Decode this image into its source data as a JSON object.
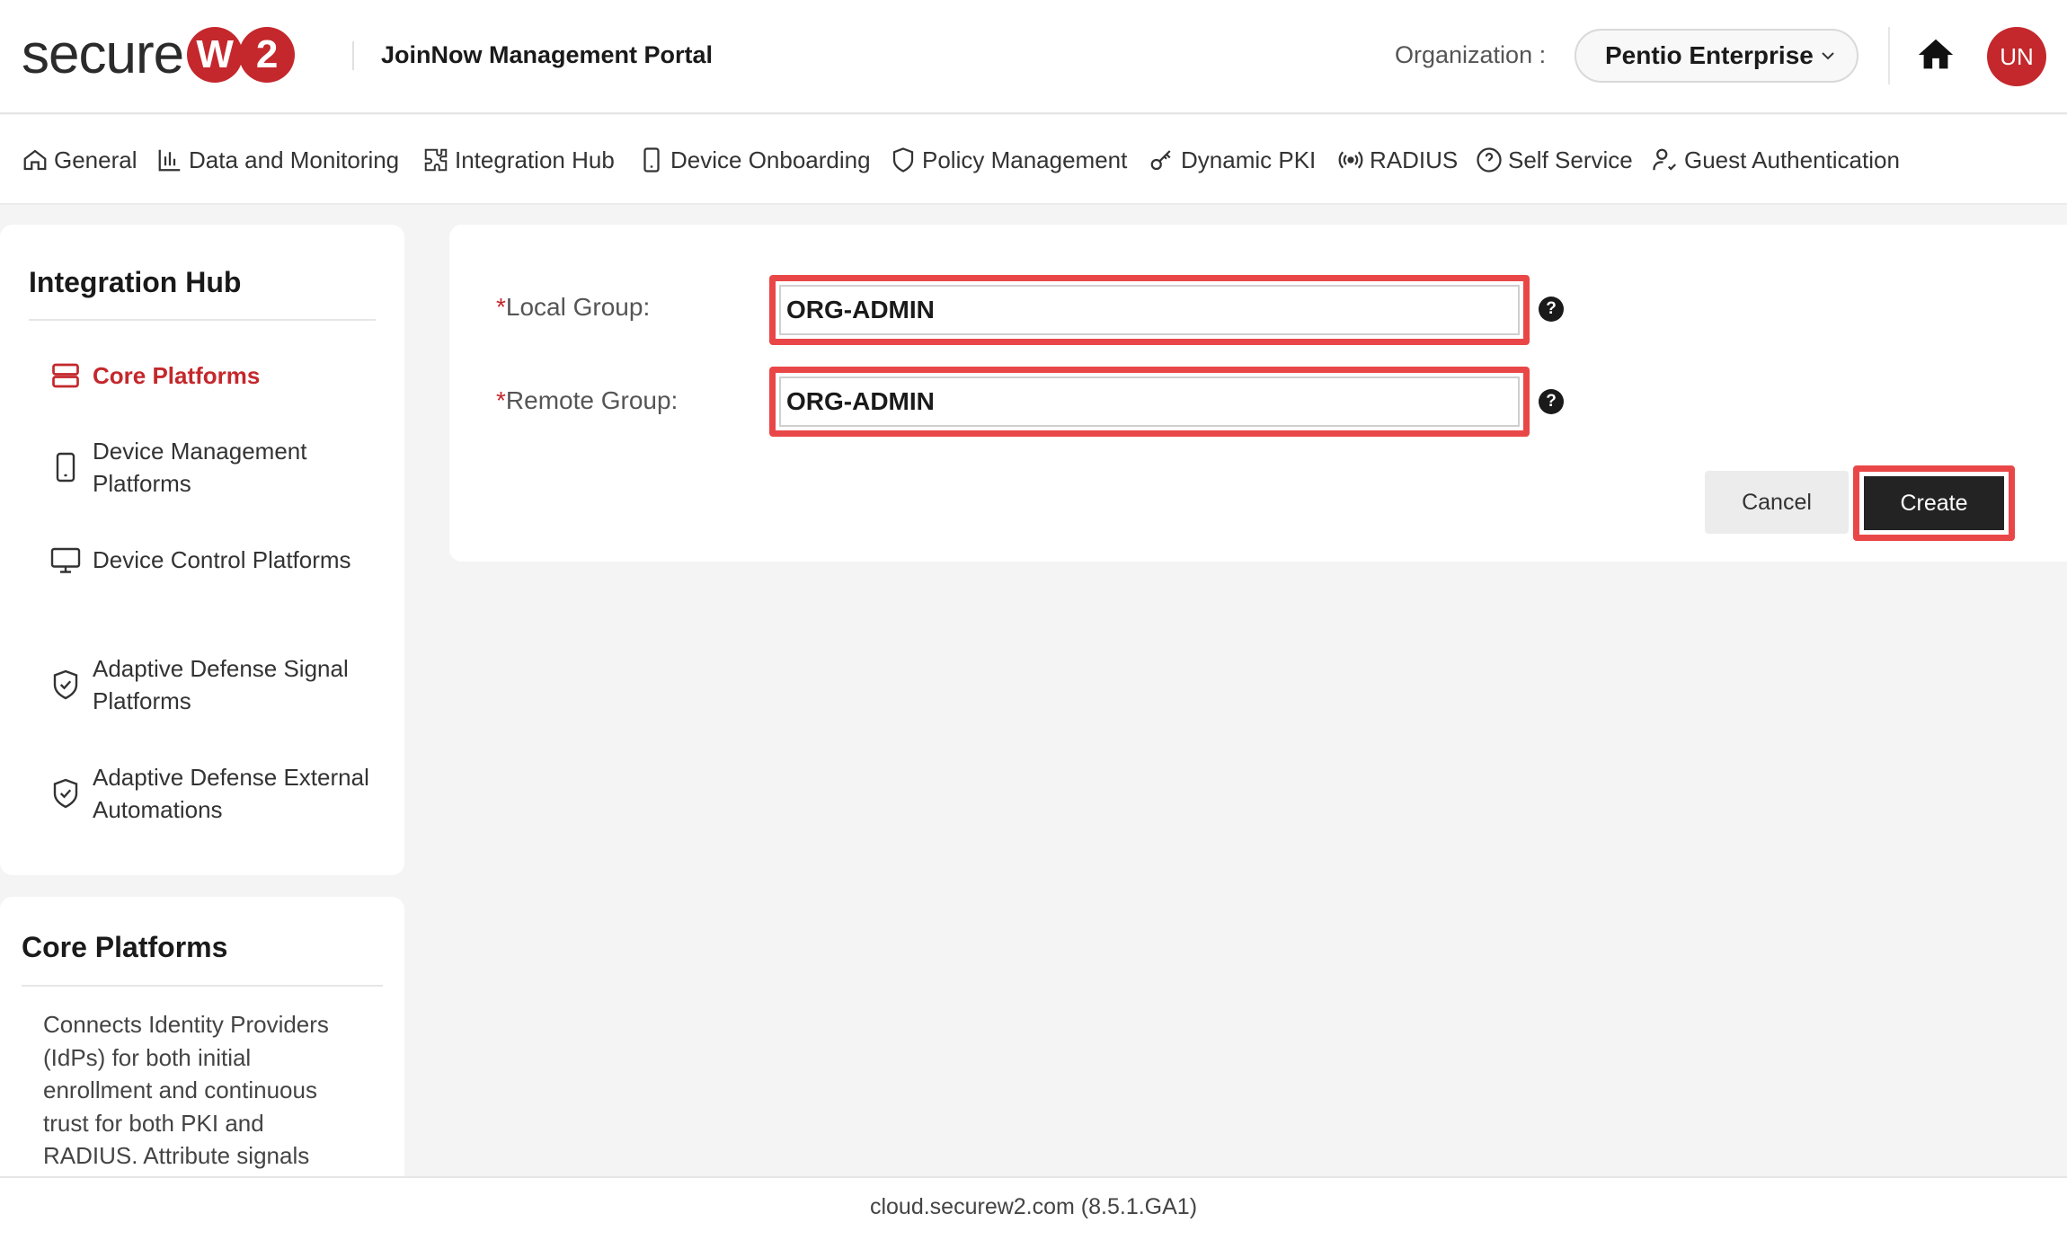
{
  "brand": {
    "logo_text": "secure",
    "logo_mark_1": "W",
    "logo_mark_2": "2",
    "accent_color": "#c4282c"
  },
  "header": {
    "portal_title": "JoinNow Management Portal",
    "org_label": "Organization :",
    "org_selected": "Pentio Enterprise",
    "home_icon": "home-icon",
    "avatar_initials": "UN"
  },
  "nav": {
    "items": [
      {
        "label": "General",
        "icon": "home-outline-icon"
      },
      {
        "label": "Data and Monitoring",
        "icon": "bar-chart-icon"
      },
      {
        "label": "Integration Hub",
        "icon": "puzzle-icon"
      },
      {
        "label": "Device Onboarding",
        "icon": "mobile-device-icon"
      },
      {
        "label": "Policy Management",
        "icon": "shield-icon"
      },
      {
        "label": "Dynamic PKI",
        "icon": "key-icon"
      },
      {
        "label": "RADIUS",
        "icon": "broadcast-icon"
      },
      {
        "label": "Self Service",
        "icon": "help-circle-icon"
      },
      {
        "label": "Guest Authentication",
        "icon": "user-check-icon"
      }
    ]
  },
  "sidebar": {
    "title": "Integration Hub",
    "items": [
      {
        "label": "Core Platforms",
        "icon": "server-icon",
        "active": true
      },
      {
        "label": "Device Management Platforms",
        "icon": "mobile-device-icon"
      },
      {
        "label": "Device Control Platforms",
        "icon": "monitor-icon"
      },
      {
        "label": "Adaptive Defense Signal Platforms",
        "icon": "shield-check-icon"
      },
      {
        "label": "Adaptive Defense External Automations",
        "icon": "shield-check-icon"
      }
    ]
  },
  "info": {
    "title": "Core Platforms",
    "text": "Connects Identity Providers (IdPs) for both initial enrollment and continuous trust for both PKI and RADIUS. Attribute signals"
  },
  "form": {
    "local_group_label": "Local Group:",
    "local_group_value": "ORG-ADMIN",
    "remote_group_label": "Remote Group:",
    "remote_group_value": "ORG-ADMIN",
    "required_marker": "*",
    "help_glyph": "?",
    "cancel_label": "Cancel",
    "create_label": "Create"
  },
  "footer": {
    "text": "cloud.securew2.com (8.5.1.GA1)"
  }
}
